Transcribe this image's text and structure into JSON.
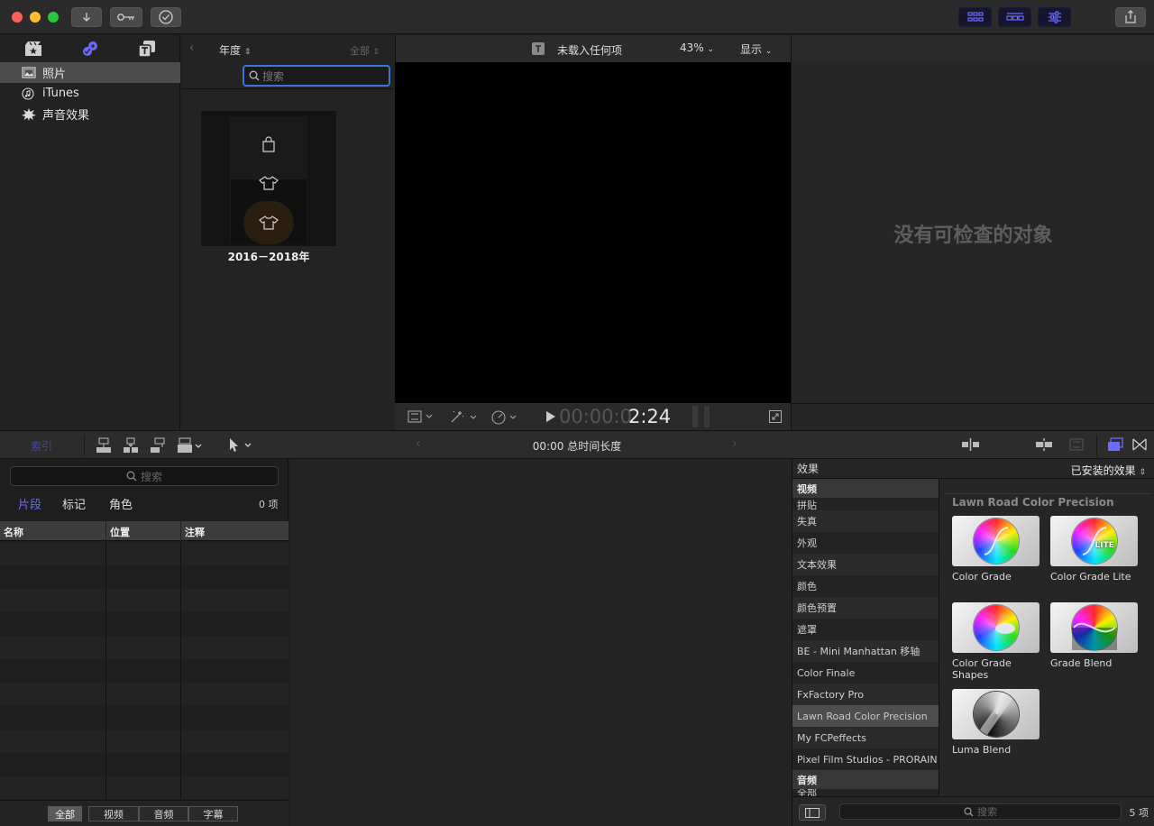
{
  "titlebar": {
    "traffic_lights": {
      "close": "#fe5f57",
      "minimize": "#febc2e",
      "zoom": "#28c840"
    },
    "left_buttons": [
      "import-icon",
      "keywords-icon",
      "background-tasks-icon"
    ],
    "right_buttons": [
      "show-libraries-icon",
      "show-timeline-icon",
      "show-inspector-icon",
      "share-icon"
    ]
  },
  "library": {
    "tabs": [
      "photos-video-library-icon",
      "photos-audio-icon",
      "titles-generators-icon"
    ],
    "items": [
      {
        "label": "照片",
        "icon": "photos-icon",
        "selected": true
      },
      {
        "label": "iTunes",
        "icon": "itunes-icon",
        "selected": false
      },
      {
        "label": "声音效果",
        "icon": "sound-effects-icon",
        "selected": false
      }
    ]
  },
  "media": {
    "group_label": "年度",
    "filter_label": "全部",
    "search_placeholder": "搜索",
    "item": {
      "title": "2016－2018年"
    }
  },
  "viewer": {
    "title": "未载入任何项",
    "zoom": "43%",
    "display_label": "显示",
    "timecode_dim": "00:00:0",
    "timecode_bright": "2:24"
  },
  "inspector": {
    "empty_text": "没有可检查的对象"
  },
  "timeline_toolbar": {
    "index_label": "索引",
    "duration": "00:00 总时间长度"
  },
  "index": {
    "search_placeholder": "搜索",
    "tabs": [
      {
        "label": "片段",
        "active": true
      },
      {
        "label": "标记",
        "active": false
      },
      {
        "label": "角色",
        "active": false
      }
    ],
    "count": "0 项",
    "columns": [
      "名称",
      "位置",
      "注释"
    ],
    "filters": [
      {
        "label": "全部",
        "active": true
      },
      {
        "label": "视频",
        "active": false
      },
      {
        "label": "音频",
        "active": false
      },
      {
        "label": "字幕",
        "active": false
      }
    ]
  },
  "effects": {
    "title": "效果",
    "installed_label": "已安装的效果",
    "categories": [
      {
        "label": "视频",
        "header": true
      },
      {
        "label": "拼贴",
        "partial": true
      },
      {
        "label": "失真"
      },
      {
        "label": "外观"
      },
      {
        "label": "文本效果"
      },
      {
        "label": "颜色"
      },
      {
        "label": "颜色预置"
      },
      {
        "label": "遮罩"
      },
      {
        "label": "BE - Mini Manhattan 移轴"
      },
      {
        "label": "Color Finale"
      },
      {
        "label": "FxFactory Pro"
      },
      {
        "label": "Lawn Road Color Precision",
        "selected": true
      },
      {
        "label": "My FCPeffects"
      },
      {
        "label": "Pixel Film Studios - PRORAIN"
      },
      {
        "label": "音频",
        "header": true
      },
      {
        "label": "全部",
        "partial": true
      }
    ],
    "group_title": "Lawn Road Color Precision",
    "items": [
      {
        "label": "Color Grade",
        "variant": "grade"
      },
      {
        "label": "Color Grade Lite",
        "variant": "lite",
        "badge": "LITE"
      },
      {
        "label": "Color Grade Shapes",
        "variant": "shapes"
      },
      {
        "label": "Grade Blend",
        "variant": "blend"
      },
      {
        "label": "Luma Blend",
        "variant": "luma"
      }
    ],
    "search_placeholder": "搜索",
    "count": "5 项"
  },
  "colors": {
    "accent": "#6b6bff",
    "search_focus": "#3b74d6"
  }
}
